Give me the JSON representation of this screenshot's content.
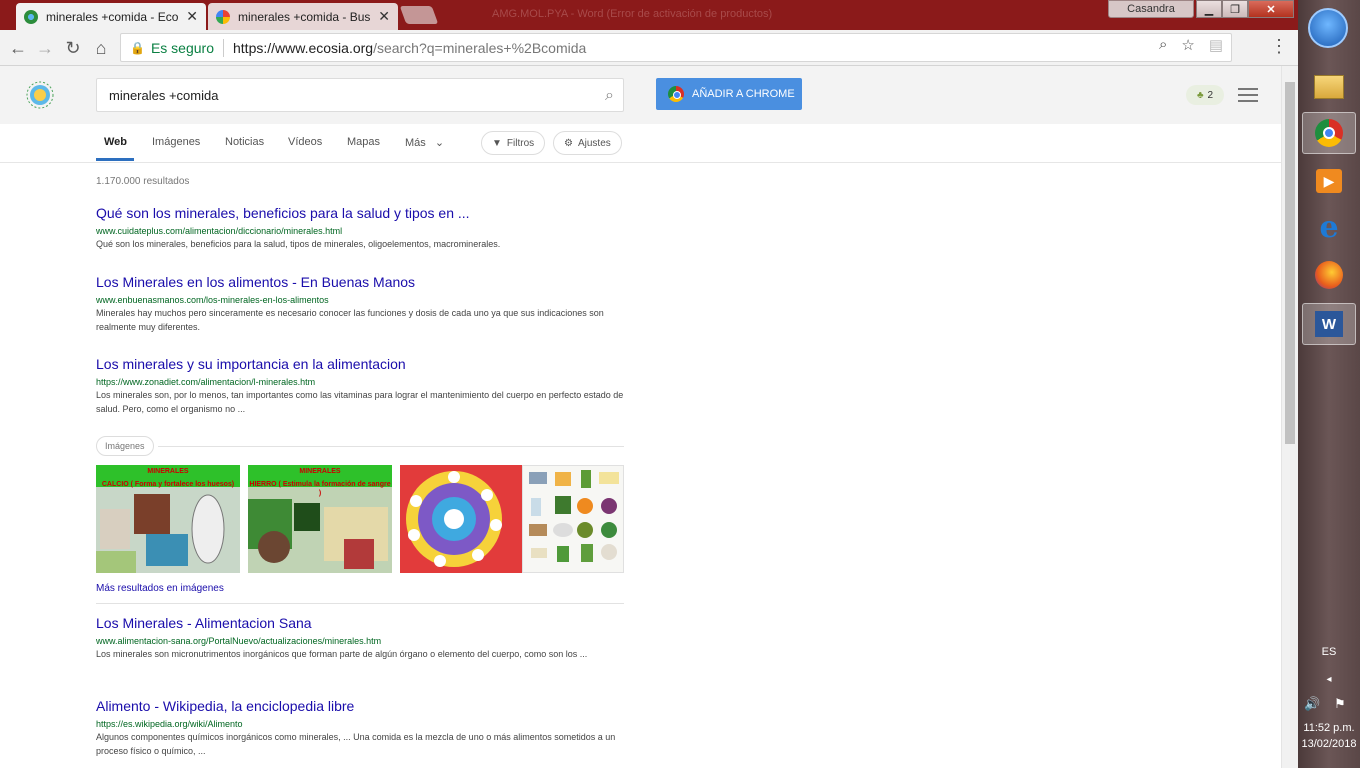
{
  "browser": {
    "tabs": [
      {
        "title": "minerales +comida - Eco",
        "active": true
      },
      {
        "title": "minerales +comida - Bus",
        "active": false
      }
    ],
    "window_title": "AMG.MOL.PYA - Word (Error de activación de productos)",
    "profile_name": "Casandra",
    "security_label": "Es seguro",
    "url_host": "https://www.ecosia.org",
    "url_path": "/search?q=minerales+%2Bcomida"
  },
  "ecosia": {
    "logo_text": "ECOSIA",
    "search_value": "minerales +comida",
    "add_to_chrome_label": "AÑADIR A CHROME",
    "tree_count": "2",
    "nav_tabs": [
      "Web",
      "Imágenes",
      "Noticias",
      "Vídeos",
      "Mapas",
      "Más"
    ],
    "filters_label": "Filtros",
    "settings_label": "Ajustes",
    "results_count": "1.170.000 resultados",
    "results": [
      {
        "title": "Qué son los minerales, beneficios para la salud y tipos en ...",
        "url": "www.cuidateplus.com/alimentacion/diccionario/minerales.html",
        "snippet": "Qué son los minerales, beneficios para la salud, tipos de minerales, oligoelementos, macrominerales."
      },
      {
        "title": "Los Minerales en los alimentos - En Buenas Manos",
        "url": "www.enbuenasmanos.com/los-minerales-en-los-alimentos",
        "snippet": "Minerales hay muchos pero sinceramente es necesario conocer las funciones y dosis de cada uno ya que sus indicaciones son realmente muy diferentes."
      },
      {
        "title": "Los minerales y su importancia en la alimentacion",
        "url": "https://www.zonadiet.com/alimentacion/l-minerales.htm",
        "snippet": "Los minerales son, por lo menos, tan importantes como las vitaminas para lograr el mantenimiento del cuerpo en perfecto estado de salud. Pero, como el organismo no ..."
      },
      {
        "title": "Los Minerales - Alimentacion Sana",
        "url": "www.alimentacion-sana.org/PortalNuevo/actualizaciones/minerales.htm",
        "snippet": "Los minerales son micronutrimentos inorgánicos que forman parte de algún órgano o elemento del cuerpo, como son los ..."
      },
      {
        "title": "Alimento - Wikipedia, la enciclopedia libre",
        "url": "https://es.wikipedia.org/wiki/Alimento",
        "snippet": "Algunos componentes químicos inorgánicos como minerales, ... Una comida es la mezcla de uno o más alimentos sometidos a un proceso físico o químico, ..."
      }
    ],
    "images_label": "Imágenes",
    "thumbs": [
      {
        "title": "MINERALES",
        "subtitle": "CALCIO ( Forma y fortalece los huesos)"
      },
      {
        "title": "MINERALES",
        "subtitle": "HIERRO ( Estimula la formación de sangre )"
      },
      {
        "title": "",
        "subtitle": ""
      },
      {
        "title": "",
        "subtitle": ""
      }
    ],
    "more_images_label": "Más resultados en imágenes"
  },
  "taskbar": {
    "lang": "ES",
    "time": "11:52 p.m.",
    "date": "13/02/2018"
  },
  "colors": {
    "titlebar": "#8b1a1a",
    "link": "#1a0dab",
    "url_green": "#006621",
    "button_blue": "#4a8fe0"
  }
}
